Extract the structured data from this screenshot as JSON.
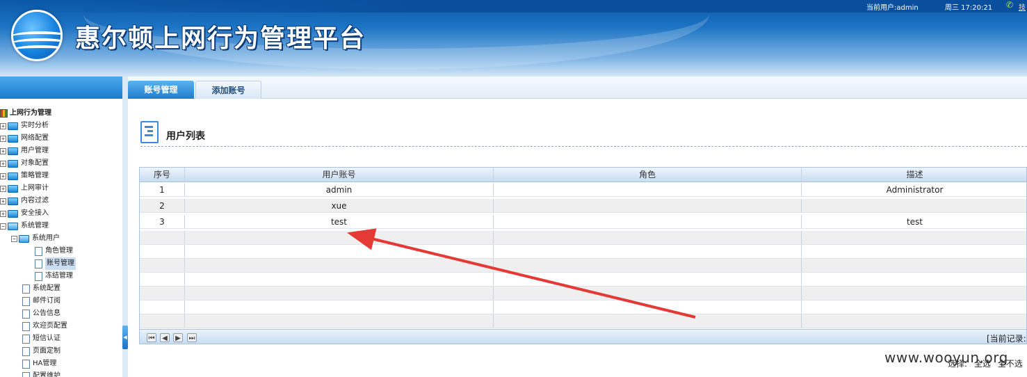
{
  "header": {
    "app_title": "惠尔顿上网行为管理平台",
    "current_user": "当前用户:admin",
    "clock": "周三  17:20:21",
    "logout": "技"
  },
  "sidebar": {
    "root": "上网行为管理",
    "items": [
      {
        "label": "实时分析"
      },
      {
        "label": "网络配置"
      },
      {
        "label": "用户管理"
      },
      {
        "label": "对象配置"
      },
      {
        "label": "策略管理"
      },
      {
        "label": "上网审计"
      },
      {
        "label": "内容过滤"
      },
      {
        "label": "安全接入"
      },
      {
        "label": "系统管理"
      }
    ],
    "system_children": [
      {
        "label": "系统用户"
      },
      {
        "label": "角色管理"
      },
      {
        "label": "账号管理"
      },
      {
        "label": "冻结管理"
      },
      {
        "label": "系统配置"
      },
      {
        "label": "邮件订阅"
      },
      {
        "label": "公告信息"
      },
      {
        "label": "欢迎页配置"
      },
      {
        "label": "短信认证"
      },
      {
        "label": "页面定制"
      },
      {
        "label": "HA管理"
      },
      {
        "label": "配置维护"
      }
    ]
  },
  "tabs": [
    {
      "label": "账号管理",
      "active": true
    },
    {
      "label": "添加账号",
      "active": false
    }
  ],
  "main": {
    "list_title": "用户列表"
  },
  "table": {
    "columns": [
      "序号",
      "用户账号",
      "角色",
      "描述"
    ],
    "rows": [
      [
        "1",
        "admin",
        "",
        "Administrator"
      ],
      [
        "2",
        "xue",
        "",
        ""
      ],
      [
        "3",
        "test",
        "",
        "test"
      ]
    ]
  },
  "pager": {
    "record": "[当前记录:"
  },
  "footer": {
    "select_label": "选择:",
    "select_all": "全选",
    "select_none": "全不选",
    "watermark": "www.wooyun.org"
  },
  "colors": {
    "accent": "#1f7dcf",
    "arrow": "#e53935"
  }
}
